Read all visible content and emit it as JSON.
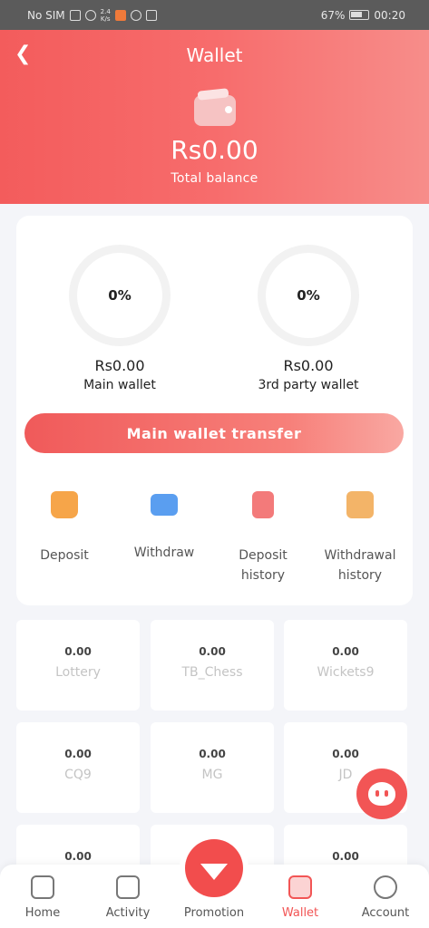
{
  "status_bar": {
    "carrier": "No SIM",
    "net_speed_top": "2.4",
    "net_speed_bottom": "K/s",
    "battery": "67%",
    "time": "00:20"
  },
  "header": {
    "title": "Wallet",
    "balance": "Rs0.00",
    "balance_label": "Total balance"
  },
  "wallets": [
    {
      "percent": "0%",
      "amount": "Rs0.00",
      "label": "Main wallet"
    },
    {
      "percent": "0%",
      "amount": "Rs0.00",
      "label": "3rd party wallet"
    }
  ],
  "transfer_button": "Main wallet transfer",
  "actions": [
    {
      "label": "Deposit",
      "icon": "deposit-icon"
    },
    {
      "label": "Withdraw",
      "icon": "withdraw-icon"
    },
    {
      "label": "Deposit history",
      "icon": "deposit-history-icon"
    },
    {
      "label": "Withdrawal history",
      "icon": "withdrawal-history-icon"
    }
  ],
  "games": [
    {
      "value": "0.00",
      "name": "Lottery"
    },
    {
      "value": "0.00",
      "name": "TB_Chess"
    },
    {
      "value": "0.00",
      "name": "Wickets9"
    },
    {
      "value": "0.00",
      "name": "CQ9"
    },
    {
      "value": "0.00",
      "name": "MG"
    },
    {
      "value": "0.00",
      "name": "JD"
    },
    {
      "value": "0.00",
      "name": ""
    },
    {
      "value": "",
      "name": ""
    },
    {
      "value": "0.00",
      "name": ""
    }
  ],
  "bottom_nav": [
    {
      "label": "Home",
      "icon": "home-icon"
    },
    {
      "label": "Activity",
      "icon": "activity-icon"
    },
    {
      "label": "Promotion",
      "icon": "promotion-icon"
    },
    {
      "label": "Wallet",
      "icon": "wallet-icon",
      "active": true
    },
    {
      "label": "Account",
      "icon": "account-icon"
    }
  ],
  "colors": {
    "accent": "#f25555",
    "header_gradient_start": "#f35c5c",
    "header_gradient_end": "#f78d8a"
  }
}
